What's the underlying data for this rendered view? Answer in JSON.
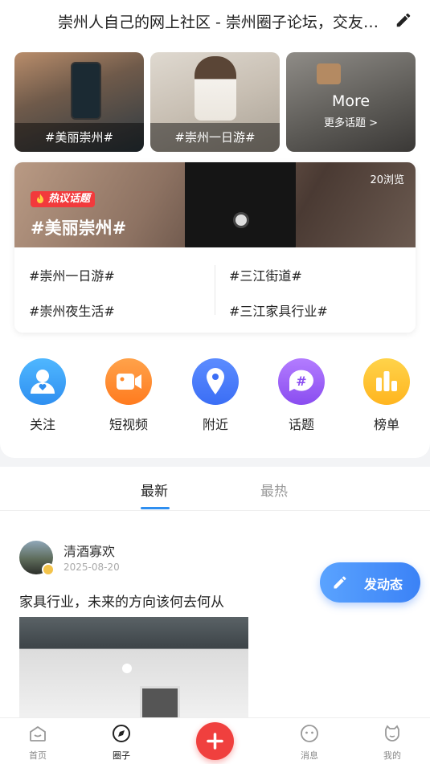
{
  "header": {
    "title": "崇州人自己的网上社区 - 崇州圈子论坛，交友、美食、旅游、生活信息分享",
    "edit_icon": "edit-icon"
  },
  "topic_tiles": [
    {
      "caption": "#美丽崇州#"
    },
    {
      "caption": "#崇州一日游#"
    },
    {
      "title": "More",
      "subtitle": "更多话题 >"
    }
  ],
  "hot_topic": {
    "badge": "热议话题",
    "title": "#美丽崇州#",
    "views": "20浏览",
    "topics": [
      "#崇州一日游#",
      "#三江街道#",
      "#崇州夜生活#",
      "#三江家具行业#"
    ]
  },
  "quick_actions": [
    {
      "label": "关注",
      "icon": "follow-icon",
      "color": "#2f8ff0"
    },
    {
      "label": "短视频",
      "icon": "video-icon",
      "color": "#ff7b1f"
    },
    {
      "label": "附近",
      "icon": "location-icon",
      "color": "#3b6ef5"
    },
    {
      "label": "话题",
      "icon": "hashtag-icon",
      "color": "#8a4df0"
    },
    {
      "label": "榜单",
      "icon": "ranking-icon",
      "color": "#ffb51f"
    }
  ],
  "feed": {
    "tabs": [
      "最新",
      "最热"
    ],
    "active_tab": "最新",
    "post": {
      "author": "清酒寡欢",
      "date": "2025-08-20",
      "text": "家具行业，未来的方向该何去何从"
    }
  },
  "fab": {
    "label": "发动态"
  },
  "bottom_nav": [
    {
      "label": "首页",
      "icon": "home-icon"
    },
    {
      "label": "圈子",
      "icon": "compass-icon"
    },
    {
      "label": "",
      "icon": "plus-icon"
    },
    {
      "label": "消息",
      "icon": "message-icon"
    },
    {
      "label": "我的",
      "icon": "profile-icon"
    }
  ],
  "colors": {
    "accent": "#2f8ff0",
    "hot": "#f23a3c",
    "plus": "#f0403e"
  }
}
